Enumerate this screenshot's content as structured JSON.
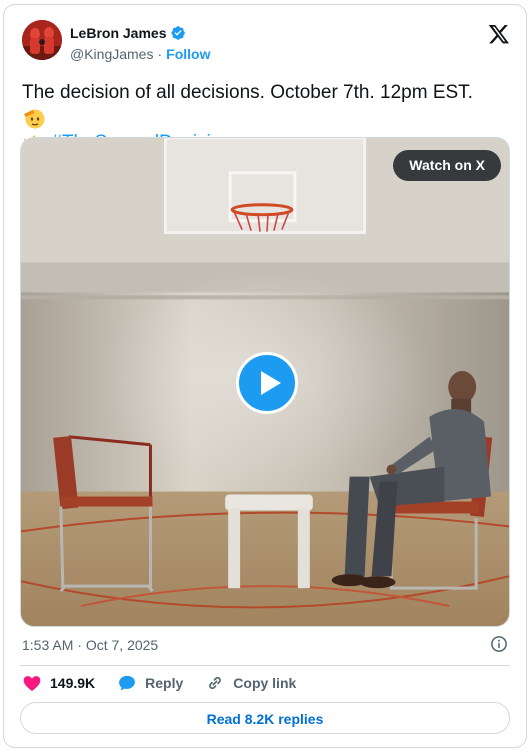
{
  "author": {
    "name": "LeBron James",
    "handle": "@KingJames",
    "separator": "·",
    "follow_label": "Follow",
    "verified_icon": "verified-badge-icon"
  },
  "brand_icon": "x-logo-icon",
  "tweet": {
    "text_part1": "The decision of all decisions. October 7th. 12pm EST.",
    "emoji_1": "saluting-face-emoji",
    "emoji_2": "crown-emoji",
    "hashtag": "#TheSecondDecision"
  },
  "media": {
    "watch_label": "Watch on X",
    "play_icon": "play-icon"
  },
  "meta": {
    "time": "1:53 AM",
    "separator": "·",
    "date": "Oct 7, 2025",
    "info_icon": "info-icon"
  },
  "actions": {
    "likes": "149.9K",
    "reply_label": "Reply",
    "copy_link_label": "Copy link"
  },
  "read_replies_label": "Read 8.2K replies",
  "colors": {
    "accent": "#1d9bf0",
    "like": "#f91880",
    "text": "#0f1419",
    "muted": "#536471",
    "border": "#cfd9de"
  }
}
